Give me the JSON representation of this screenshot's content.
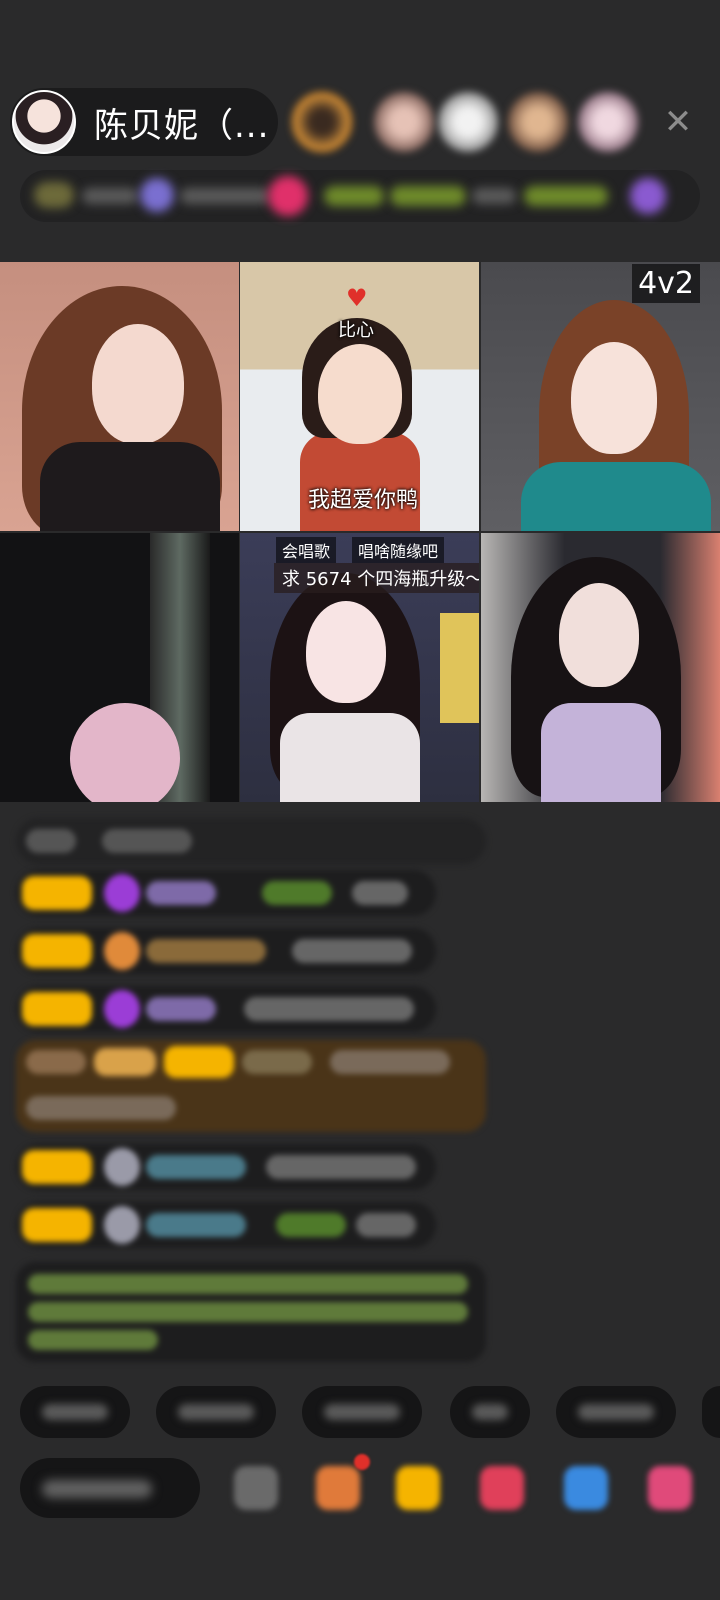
{
  "header": {
    "host_name": "陈贝妮（...",
    "viewers": [
      {
        "name": "viewer-1",
        "color": "#c98b3a"
      },
      {
        "name": "viewer-2",
        "color": "#b68b7f"
      },
      {
        "name": "viewer-3",
        "color": "#cfcfcf"
      },
      {
        "name": "viewer-4",
        "color": "#b88a6e"
      },
      {
        "name": "viewer-5",
        "color": "#c7a7b7"
      }
    ],
    "close_symbol": "✕"
  },
  "video_grid": {
    "tiles": [
      {
        "position": "top-left",
        "caption": ""
      },
      {
        "position": "top-center",
        "sticker": "比心",
        "caption": "我超爱你鸭"
      },
      {
        "position": "top-right",
        "badge": "4v2"
      },
      {
        "position": "bottom-left",
        "caption": ""
      },
      {
        "position": "bottom-center",
        "tag1": "会唱歌",
        "tag2": "唱啥随缘吧",
        "goal": "求 5674 个四海瓶升级～"
      },
      {
        "position": "bottom-right",
        "caption": ""
      }
    ]
  },
  "colors": {
    "background": "#2a2a2b",
    "pill_bg": "#1b1b1c",
    "level_badge": "#f5b400",
    "chat_green": "#7bbf3a",
    "chat_purple": "#9b59d0"
  }
}
